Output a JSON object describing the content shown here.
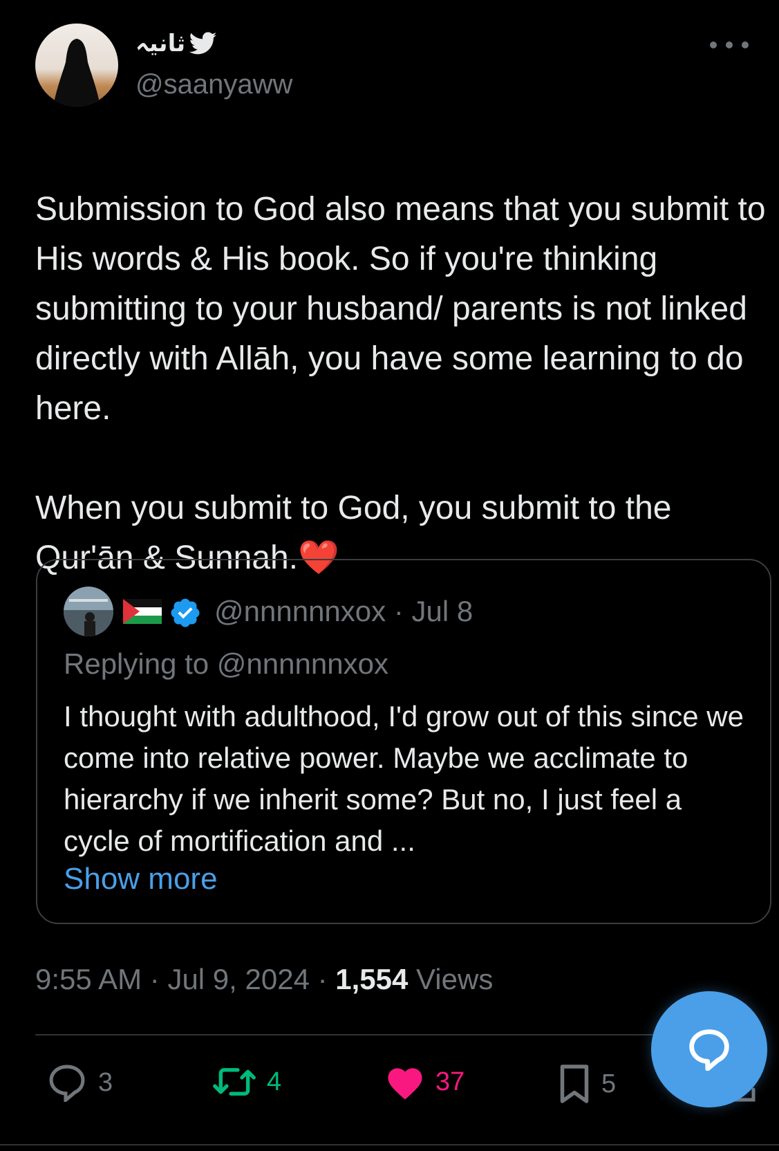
{
  "tweet": {
    "display_name": "ثانیہ",
    "handle": "@saanyaww",
    "text_line1": "Submission to God also means that you submit to His words & His book. So if you're thinking submitting to your husband/ parents is not linked directly with Allāh, you have some learning to do here.",
    "text_line2": "When you submit to God, you submit to the Qur'ān & Sunnah.",
    "emoji": "❤️",
    "time": "9:55 AM",
    "date": "Jul 9, 2024",
    "views_count": "1,554",
    "views_label": "Views",
    "separator": " · "
  },
  "quote": {
    "handle": "@nnnnnnxox",
    "date": "Jul 8",
    "replying_prefix": "Replying to ",
    "replying_handle": "@nnnnnnxox",
    "text": "I thought with adulthood, I'd grow out of this since we come into relative power. Maybe we acclimate to hierarchy if we inherit some? But no, I just feel a cycle of mortification and ...",
    "show_more": "Show more"
  },
  "actions": {
    "replies": "3",
    "retweets": "4",
    "likes": "37",
    "bookmarks": "5"
  },
  "icons": {
    "verified": "verified-badge-icon",
    "bird": "bird-icon",
    "flag": "palestine-flag-icon",
    "more": "more-icon",
    "reply": "reply-icon",
    "retweet": "retweet-icon",
    "like": "heart-icon",
    "bookmark": "bookmark-icon",
    "share": "share-icon",
    "compose": "compose-reply-icon"
  },
  "colors": {
    "background": "#000000",
    "text": "#e7e9ea",
    "muted": "#71767b",
    "link": "#4a9fe8",
    "retweet": "#00ba7c",
    "like": "#f91880",
    "fab": "#4a9fe8"
  }
}
